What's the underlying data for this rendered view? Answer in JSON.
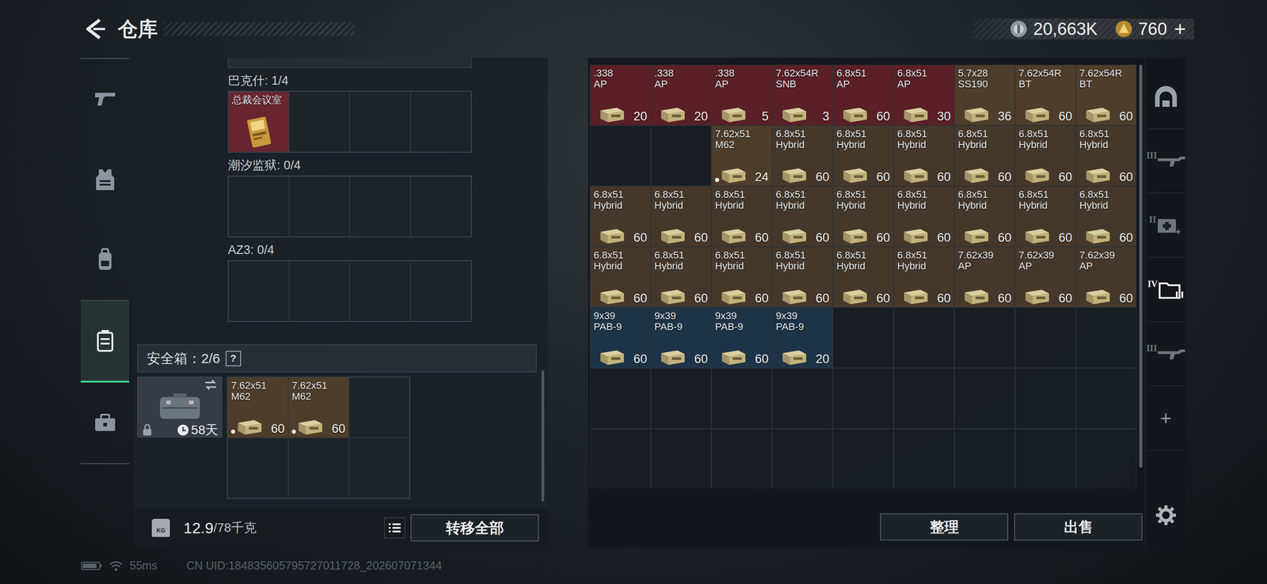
{
  "header": {
    "title": "仓库",
    "currency": [
      {
        "amount": "20,663K",
        "kind": "silver"
      },
      {
        "amount": "760",
        "kind": "gold"
      }
    ],
    "add": "+"
  },
  "nav": [
    {
      "selected": false
    },
    {
      "selected": false
    },
    {
      "selected": false
    },
    {
      "selected": true
    },
    {
      "selected": false
    }
  ],
  "containers": [
    {
      "label": "巴克什: 1/4",
      "slots": [
        {
          "kind": "key",
          "name": "总裁会议室",
          "color": "#6a2530"
        },
        {
          "kind": "empty"
        },
        {
          "kind": "empty"
        },
        {
          "kind": "empty"
        }
      ]
    },
    {
      "label": "潮汐监狱: 0/4",
      "slots": [
        {
          "kind": "empty"
        },
        {
          "kind": "empty"
        },
        {
          "kind": "empty"
        },
        {
          "kind": "empty"
        }
      ]
    },
    {
      "label": "AZ3: 0/4",
      "slots": [
        {
          "kind": "empty"
        },
        {
          "kind": "empty"
        },
        {
          "kind": "empty"
        },
        {
          "kind": "empty"
        }
      ]
    }
  ],
  "safe": {
    "label": "安全箱：2/6",
    "help": "?",
    "days": "58天",
    "slots": [
      {
        "kind": "ammo",
        "caliber": "7.62x51",
        "type": "M62",
        "count": "60",
        "marked": true,
        "color": "#4e3d2a"
      },
      {
        "kind": "ammo",
        "caliber": "7.62x51",
        "type": "M62",
        "count": "60",
        "marked": true,
        "color": "#4e3d2a"
      },
      {
        "kind": "empty"
      },
      {
        "kind": "empty"
      },
      {
        "kind": "empty"
      },
      {
        "kind": "empty"
      }
    ]
  },
  "weight": {
    "icon_label": "KG",
    "current": "12.9",
    "max": "/78千克"
  },
  "buttons": {
    "transfer": "转移全部",
    "sort": "整理",
    "sell": "出售"
  },
  "stash": {
    "cells": [
      {
        "kind": "ammo",
        "caliber": ".338",
        "type": "AP",
        "count": "20",
        "marked": false,
        "color": "#5b1f27"
      },
      {
        "kind": "ammo",
        "caliber": ".338",
        "type": "AP",
        "count": "20",
        "marked": false,
        "color": "#5b1f27"
      },
      {
        "kind": "ammo",
        "caliber": ".338",
        "type": "AP",
        "count": "5",
        "marked": false,
        "color": "#5b1f27"
      },
      {
        "kind": "ammo",
        "caliber": "7.62x54R",
        "type": "SNB",
        "count": "3",
        "marked": false,
        "color": "#5b1f27"
      },
      {
        "kind": "ammo",
        "caliber": "6.8x51",
        "type": "AP",
        "count": "60",
        "marked": false,
        "color": "#5b1f27"
      },
      {
        "kind": "ammo",
        "caliber": "6.8x51",
        "type": "AP",
        "count": "30",
        "marked": false,
        "color": "#5b1f27"
      },
      {
        "kind": "ammo",
        "caliber": "5.7x28",
        "type": "SS190",
        "count": "36",
        "marked": false,
        "color": "#4e3d2a"
      },
      {
        "kind": "ammo",
        "caliber": "7.62x54R",
        "type": "BT",
        "count": "60",
        "marked": false,
        "color": "#4e3d2a"
      },
      {
        "kind": "ammo",
        "caliber": "7.62x54R",
        "type": "BT",
        "count": "60",
        "marked": false,
        "color": "#4e3d2a"
      },
      {
        "kind": "empty"
      },
      {
        "kind": "empty"
      },
      {
        "kind": "ammo",
        "caliber": "7.62x51",
        "type": "M62",
        "count": "24",
        "marked": true,
        "color": "#4e3d2a"
      },
      {
        "kind": "ammo",
        "caliber": "6.8x51",
        "type": "Hybrid",
        "count": "60",
        "marked": false,
        "color": "#45382b"
      },
      {
        "kind": "ammo",
        "caliber": "6.8x51",
        "type": "Hybrid",
        "count": "60",
        "marked": false,
        "color": "#45382b"
      },
      {
        "kind": "ammo",
        "caliber": "6.8x51",
        "type": "Hybrid",
        "count": "60",
        "marked": false,
        "color": "#45382b"
      },
      {
        "kind": "ammo",
        "caliber": "6.8x51",
        "type": "Hybrid",
        "count": "60",
        "marked": false,
        "color": "#45382b"
      },
      {
        "kind": "ammo",
        "caliber": "6.8x51",
        "type": "Hybrid",
        "count": "60",
        "marked": false,
        "color": "#45382b"
      },
      {
        "kind": "ammo",
        "caliber": "6.8x51",
        "type": "Hybrid",
        "count": "60",
        "marked": false,
        "color": "#45382b"
      },
      {
        "kind": "ammo",
        "caliber": "6.8x51",
        "type": "Hybrid",
        "count": "60",
        "marked": false,
        "color": "#45382b"
      },
      {
        "kind": "ammo",
        "caliber": "6.8x51",
        "type": "Hybrid",
        "count": "60",
        "marked": false,
        "color": "#45382b"
      },
      {
        "kind": "ammo",
        "caliber": "6.8x51",
        "type": "Hybrid",
        "count": "60",
        "marked": false,
        "color": "#45382b"
      },
      {
        "kind": "ammo",
        "caliber": "6.8x51",
        "type": "Hybrid",
        "count": "60",
        "marked": false,
        "color": "#45382b"
      },
      {
        "kind": "ammo",
        "caliber": "6.8x51",
        "type": "Hybrid",
        "count": "60",
        "marked": false,
        "color": "#45382b"
      },
      {
        "kind": "ammo",
        "caliber": "6.8x51",
        "type": "Hybrid",
        "count": "60",
        "marked": false,
        "color": "#45382b"
      },
      {
        "kind": "ammo",
        "caliber": "6.8x51",
        "type": "Hybrid",
        "count": "60",
        "marked": false,
        "color": "#45382b"
      },
      {
        "kind": "ammo",
        "caliber": "6.8x51",
        "type": "Hybrid",
        "count": "60",
        "marked": false,
        "color": "#45382b"
      },
      {
        "kind": "ammo",
        "caliber": "6.8x51",
        "type": "Hybrid",
        "count": "60",
        "marked": false,
        "color": "#45382b"
      },
      {
        "kind": "ammo",
        "caliber": "6.8x51",
        "type": "Hybrid",
        "count": "60",
        "marked": false,
        "color": "#45382b"
      },
      {
        "kind": "ammo",
        "caliber": "6.8x51",
        "type": "Hybrid",
        "count": "60",
        "marked": false,
        "color": "#45382b"
      },
      {
        "kind": "ammo",
        "caliber": "6.8x51",
        "type": "Hybrid",
        "count": "60",
        "marked": false,
        "color": "#45382b"
      },
      {
        "kind": "ammo",
        "caliber": "6.8x51",
        "type": "Hybrid",
        "count": "60",
        "marked": false,
        "color": "#45382b"
      },
      {
        "kind": "ammo",
        "caliber": "6.8x51",
        "type": "Hybrid",
        "count": "60",
        "marked": false,
        "color": "#45382b"
      },
      {
        "kind": "ammo",
        "caliber": "6.8x51",
        "type": "Hybrid",
        "count": "60",
        "marked": false,
        "color": "#45382b"
      },
      {
        "kind": "ammo",
        "caliber": "7.62x39",
        "type": "AP",
        "count": "60",
        "marked": false,
        "color": "#45382b"
      },
      {
        "kind": "ammo",
        "caliber": "7.62x39",
        "type": "AP",
        "count": "60",
        "marked": false,
        "color": "#45382b"
      },
      {
        "kind": "ammo",
        "caliber": "7.62x39",
        "type": "AP",
        "count": "60",
        "marked": false,
        "color": "#45382b"
      },
      {
        "kind": "ammo",
        "caliber": "9x39",
        "type": "PAB-9",
        "count": "60",
        "marked": false,
        "color": "#1d3347"
      },
      {
        "kind": "ammo",
        "caliber": "9x39",
        "type": "PAB-9",
        "count": "60",
        "marked": false,
        "color": "#1d3347"
      },
      {
        "kind": "ammo",
        "caliber": "9x39",
        "type": "PAB-9",
        "count": "60",
        "marked": false,
        "color": "#1d3347"
      },
      {
        "kind": "ammo",
        "caliber": "9x39",
        "type": "PAB-9",
        "count": "20",
        "marked": false,
        "color": "#1d3347"
      }
    ]
  },
  "rail": [
    {
      "kind": "vault",
      "badge": "",
      "selected": false
    },
    {
      "kind": "rifle",
      "badge": "III",
      "selected": false
    },
    {
      "kind": "medkit",
      "badge": "II",
      "selected": false
    },
    {
      "kind": "folder",
      "badge": "IV",
      "selected": true
    },
    {
      "kind": "rifle",
      "badge": "III",
      "selected": false
    },
    {
      "kind": "add",
      "badge": "+",
      "selected": false
    }
  ],
  "status": {
    "ping": "55ms",
    "uid": "CN UID:184835605795727011728_202607071344"
  }
}
